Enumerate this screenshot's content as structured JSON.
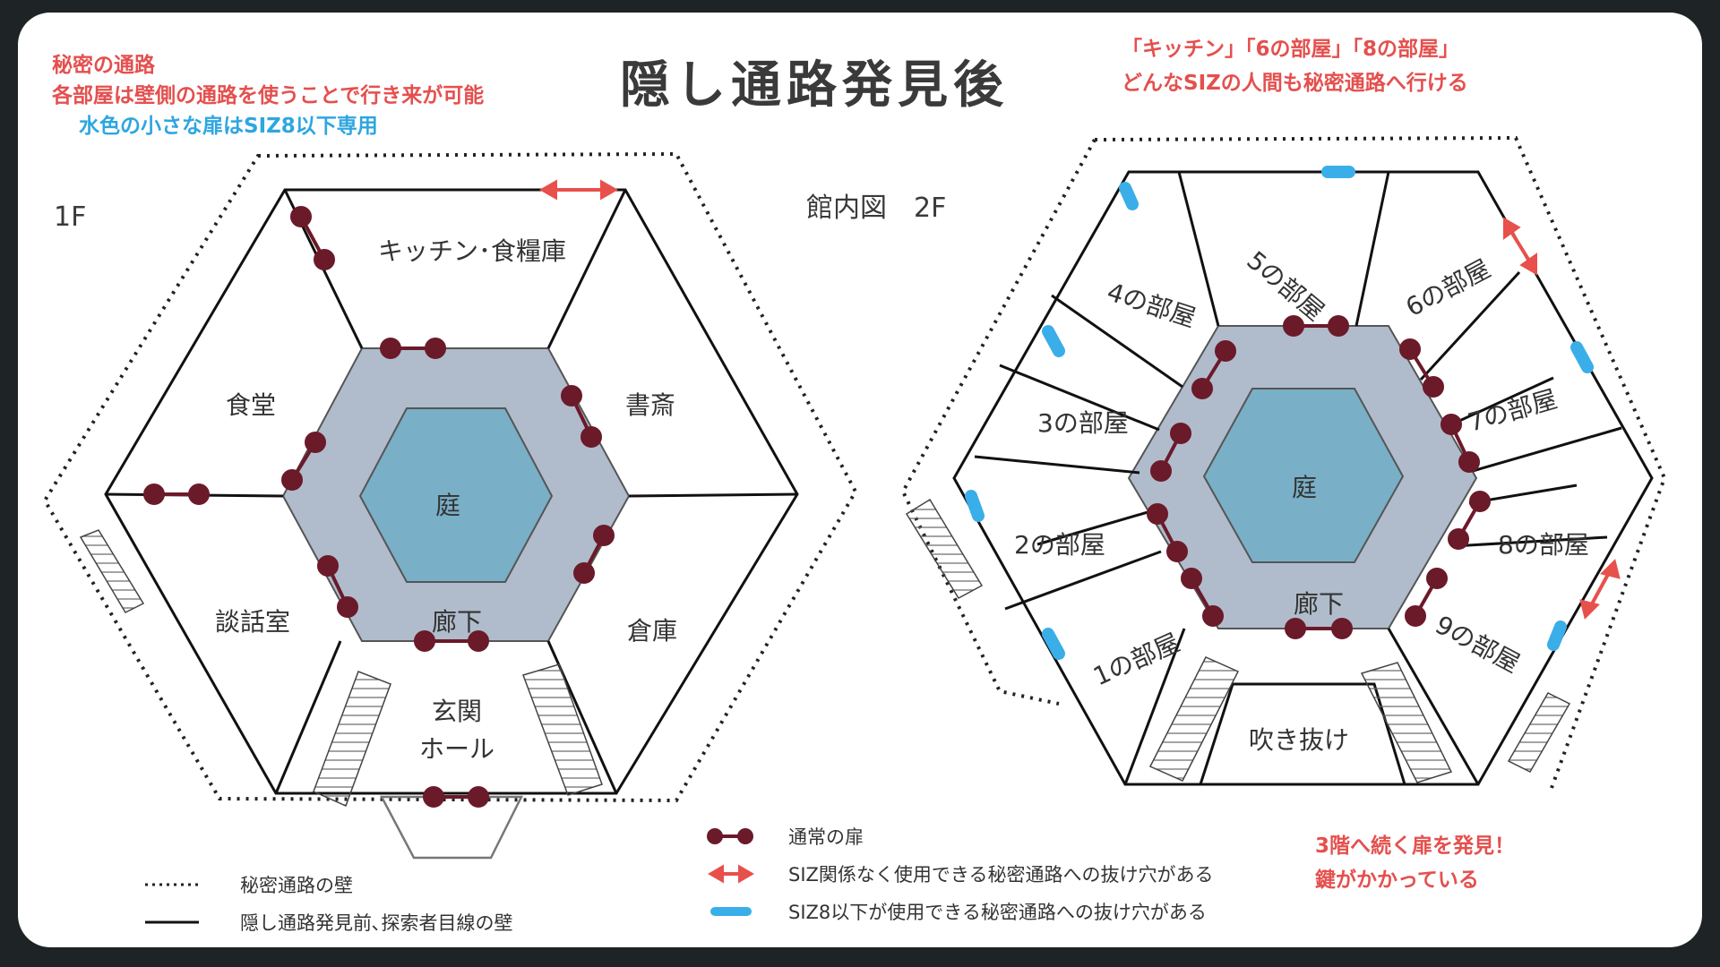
{
  "title": "隠し通路発見後",
  "notes": {
    "top_left": [
      "秘密の通路",
      "各部屋は壁側の通路を使うことで行き来が可能"
    ],
    "top_left_blue": "水色の小さな扉はSIZ8以下専用",
    "top_right": [
      "「キッチン」「6の部屋」「8の部屋」",
      "どんなSIZの人間も秘密通路へ行ける"
    ],
    "bottom_right": [
      "3階へ続く扉を発見！",
      "鍵がかかっている"
    ]
  },
  "floor1": {
    "label": "1F",
    "rooms": {
      "kitchen": "キッチン･食糧庫",
      "study": "書斎",
      "dining": "食堂",
      "lounge": "談話室",
      "storage": "倉庫",
      "entrance_line1": "玄関",
      "entrance_line2": "ホール",
      "garden": "庭",
      "corridor": "廊下"
    }
  },
  "floor2": {
    "label": "館内図　2F",
    "rooms": {
      "r1": "1の部屋",
      "r2": "2の部屋",
      "r3": "3の部屋",
      "r4": "4の部屋",
      "r5": "5の部屋",
      "r6": "6の部屋",
      "r7": "7の部屋",
      "r8": "8の部屋",
      "r9": "9の部屋",
      "atrium": "吹き抜け",
      "garden": "庭",
      "corridor": "廊下"
    }
  },
  "legend": {
    "dotted_wall": "秘密通路の壁",
    "solid_wall": "隠し通路発見前､探索者目線の壁",
    "normal_door": "通常の扉",
    "any_siz_hole": "SIZ関係なく使用できる秘密通路への抜け穴がある",
    "siz8_hole": "SIZ8以下が使用できる秘密通路への抜け穴がある"
  },
  "colors": {
    "door": "#6b1a2a",
    "secret_arrow": "#e8504c",
    "small_door": "#3aaee8",
    "corridor_fill": "#b0bccb",
    "garden_fill": "#79afc7"
  }
}
